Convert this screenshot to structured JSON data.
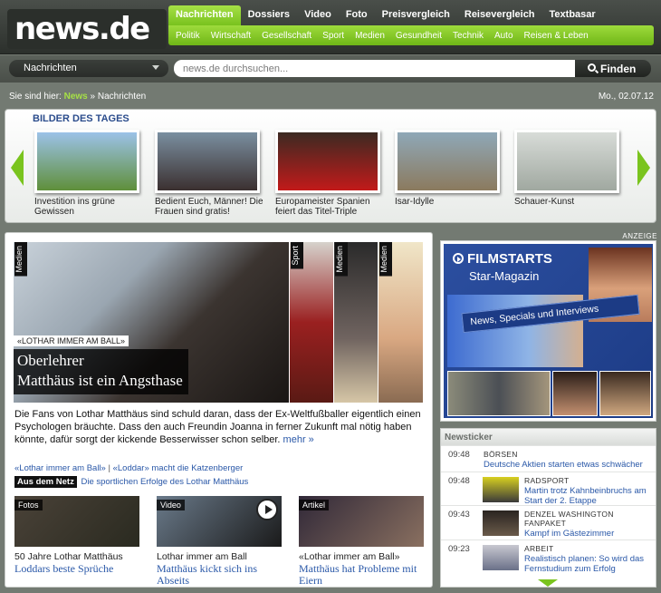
{
  "brand": {
    "logo_text": "news.de"
  },
  "main_nav": [
    {
      "label": "Nachrichten",
      "active": true
    },
    {
      "label": "Dossiers"
    },
    {
      "label": "Video"
    },
    {
      "label": "Foto"
    },
    {
      "label": "Preisvergleich"
    },
    {
      "label": "Reisevergleich"
    },
    {
      "label": "Textbasar"
    }
  ],
  "sub_nav": [
    "Politik",
    "Wirtschaft",
    "Gesellschaft",
    "Sport",
    "Medien",
    "Gesundheit",
    "Technik",
    "Auto",
    "Reisen & Leben"
  ],
  "search": {
    "section": "Nachrichten",
    "placeholder": "news.de durchsuchen...",
    "button": "Finden"
  },
  "breadcrumb": {
    "prefix": "Sie sind hier:",
    "home": "News",
    "separator": "»",
    "current": "Nachrichten",
    "date": "Mo., 02.07.12"
  },
  "gallery": {
    "title": "BILDER DES TAGES",
    "items": [
      {
        "caption": "Investition ins grüne Gewissen",
        "colors": [
          "#9cc2e8",
          "#5f8f3a"
        ]
      },
      {
        "caption": "Bedient Euch, Männer! Die Frauen sind gratis!",
        "colors": [
          "#7a8fa0",
          "#3b3030"
        ]
      },
      {
        "caption": "Europameister Spanien feiert das Titel-Triple",
        "colors": [
          "#3c2a22",
          "#c21a1a"
        ]
      },
      {
        "caption": "Isar-Idylle",
        "colors": [
          "#8fa8b8",
          "#8b7a5e"
        ]
      },
      {
        "caption": "Schauer-Kunst",
        "colors": [
          "#d8dcd8",
          "#a0a8a0"
        ]
      }
    ]
  },
  "hero": {
    "tags": [
      "Medien",
      "Sport",
      "Medien",
      "Medien"
    ],
    "kicker": "«LOTHAR IMMER AM BALL»",
    "title_lines": [
      "Oberlehrer",
      "Matthäus ist ein Angsthase"
    ],
    "text": "Die Fans von Lothar Matthäus sind schuld daran, dass der Ex-Weltfußballer eigentlich einen Psychologen bräuchte. Dass den auch Freundin Joanna in ferner Zukunft mal nötig haben könnte, dafür sorgt der kickende Besserwisser schon selber.",
    "more": "mehr »",
    "links": [
      "«Lothar immer am Ball»",
      "«Loddar» macht die Katzenberger"
    ],
    "link_separator": "|",
    "netz_badge": "Aus dem Netz",
    "netz_link": "Die sportlichen Erfolge des Lothar Matthäus"
  },
  "sub_teasers": [
    {
      "tag": "Fotos",
      "kicker": "50 Jahre Lothar Matthäus",
      "title": "Loddars beste Sprüche",
      "colors": [
        "#4a4238",
        "#2a2a20"
      ]
    },
    {
      "tag": "Video",
      "kicker": "Lothar immer am Ball",
      "title": "Matthäus kickt sich ins Abseits",
      "colors": [
        "#6a7a8a",
        "#1a1a1a"
      ]
    },
    {
      "tag": "Artikel",
      "kicker": "«Lothar immer am Ball»",
      "title": "Matthäus hat Probleme mit Eiern",
      "colors": [
        "#302838",
        "#8a7060"
      ]
    }
  ],
  "ad": {
    "label": "ANZEIGE",
    "logo": "FILMSTARTS",
    "magazine": "Star-Magazin",
    "band": "News, Specials und Interviews"
  },
  "newsticker": {
    "title": "Newsticker",
    "items": [
      {
        "time": "09:48",
        "category": "BÖRSEN",
        "text": "Deutsche Aktien starten etwas schwächer",
        "has_thumb": false
      },
      {
        "time": "09:48",
        "category": "RADSPORT",
        "text": "Martin trotz Kahnbeinbruchs am Start der 2. Etappe",
        "has_thumb": true,
        "thumb_colors": [
          "#d8d020",
          "#3a3a3a"
        ]
      },
      {
        "time": "09:43",
        "category": "DENZEL WASHINGTON FANPAKET",
        "text": "Kampf im Gästezimmer",
        "has_thumb": true,
        "thumb_colors": [
          "#2a2420",
          "#6a5a4a"
        ]
      },
      {
        "time": "09:23",
        "category": "ARBEIT",
        "text": "Realistisch planen: So wird das Fernstudium zum Erfolg",
        "has_thumb": true,
        "thumb_colors": [
          "#c8c8d0",
          "#6a7088"
        ]
      }
    ]
  }
}
